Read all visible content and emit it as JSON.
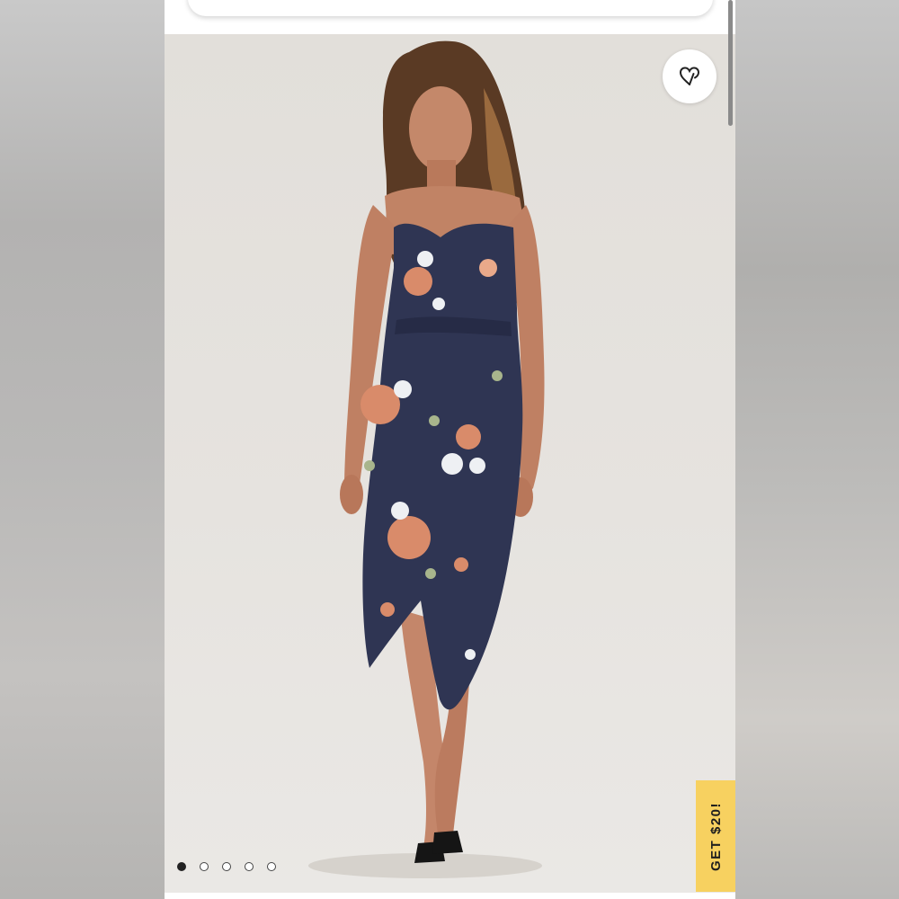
{
  "page": {
    "wishlist_icon": "heart-outline-icon",
    "carousel": {
      "total_slides": 5,
      "active_index": 0
    },
    "promo": {
      "label": "GET $20!",
      "color": "#f7d160"
    },
    "colors": {
      "dress": "#2f3553",
      "flower_peach": "#d98b6a",
      "flower_white": "#eef0f3",
      "backdrop": "#e4e1dd"
    }
  }
}
